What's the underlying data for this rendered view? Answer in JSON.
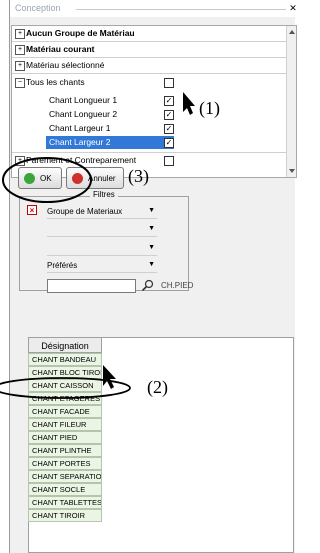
{
  "window": {
    "title": "Conception",
    "close_glyph": "✕"
  },
  "tree": {
    "rows": [
      {
        "label": "Aucun Groupe de Matériau",
        "toggle": "+"
      },
      {
        "label": "Matériau courant",
        "toggle": "+"
      },
      {
        "label": "Matériau sélectionné",
        "toggle": "+"
      },
      {
        "label": "Tous les chants",
        "toggle": "−"
      },
      {
        "label": "Chant Longueur 1",
        "checked": "✓"
      },
      {
        "label": "Chant Longueur 2",
        "checked": "✓"
      },
      {
        "label": "Chant Largeur 1",
        "checked": "✓"
      },
      {
        "label": "Chant Largeur 2",
        "checked": "✓"
      },
      {
        "label": "Parement et Contreparement",
        "toggle": "+"
      }
    ]
  },
  "buttons": {
    "ok_label": "OK",
    "cancel_label": "Annuler"
  },
  "filters": {
    "legend": "Filtres",
    "group_combo": "Groupe de Materiaux",
    "preferes_combo": "Préférés",
    "search_caption": "CH.PIED",
    "search_value": ""
  },
  "grid": {
    "header": "Désignation",
    "rows": [
      "CHANT BANDEAU",
      "CHANT BLOC TIROIR",
      "CHANT CAISSON",
      "CHANT ETAGERES",
      "CHANT FACADE",
      "CHANT FILEUR",
      "CHANT PIED",
      "CHANT PLINTHE",
      "CHANT PORTES",
      "CHANT SEPARATION",
      "CHANT SOCLE",
      "CHANT TABLETTES",
      "CHANT TIROIR"
    ]
  },
  "annotations": {
    "a1": "(1)",
    "a2": "(2)",
    "a3": "(3)"
  },
  "colors": {
    "selection": "#3278d6",
    "grid_row": "#eaf5e4",
    "ok_icon": "#3aa53a",
    "cancel_icon": "#d0312d"
  }
}
